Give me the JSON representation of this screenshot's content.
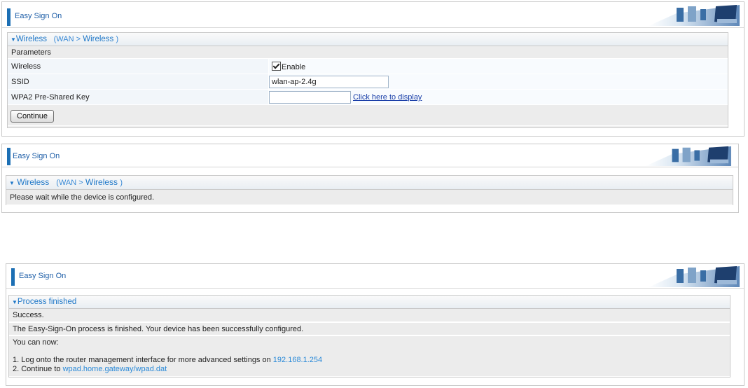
{
  "panel1": {
    "title": "Easy Sign On",
    "section": {
      "title": "Wireless",
      "path_open": "(WAN >",
      "path_link": "Wireless",
      "path_close": ")"
    },
    "params_label": "Parameters",
    "wireless_label": "Wireless",
    "enable_label": "Enable",
    "enable_checked": true,
    "ssid_label": "SSID",
    "ssid_value": "wlan-ap-2.4g",
    "psk_label": "WPA2 Pre-Shared Key",
    "psk_value": "",
    "display_link": "Click here to display",
    "continue_label": "Continue"
  },
  "panel2": {
    "title": "Easy Sign On",
    "section": {
      "title": "Wireless",
      "path_open": "(WAN >",
      "path_link": "Wireless",
      "path_close": ")"
    },
    "wait_text": "Please wait while the device is configured."
  },
  "panel3": {
    "title": "Easy Sign On",
    "section_title": "Process finished",
    "success": "Success.",
    "finished_text": "The Easy-Sign-On process is finished. Your device has been successfully configured.",
    "you_can_now": "You can now:",
    "step1_text": "1. Log onto the router management interface for more advanced settings on",
    "step1_ip": "192.168.1.254",
    "step2_text": "2. Continue to",
    "step2_link": "wpad.home.gateway/wpad.dat"
  },
  "colors": {
    "accent": "#1c6fb4",
    "link": "#1a3fa8",
    "section_title": "#1f78c8"
  },
  "icons": {
    "header_graphic": "office-chairs-banner-icon",
    "section_arrow": "triangle-down-icon"
  }
}
